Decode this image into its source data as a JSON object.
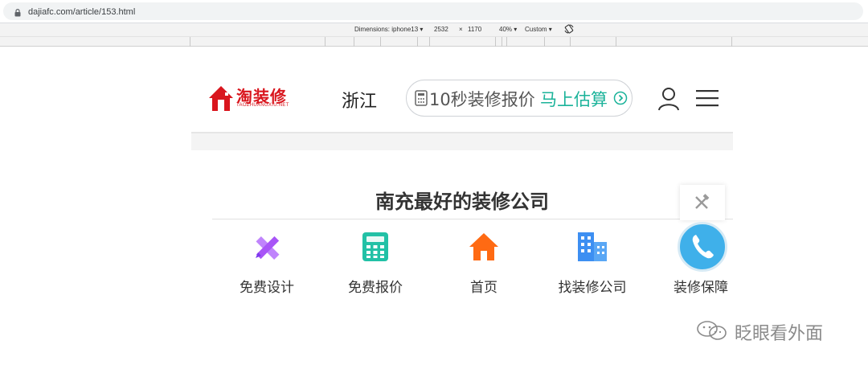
{
  "browser": {
    "url": "dajiafc.com/article/153.html"
  },
  "devtools": {
    "dimensions_label": "Dimensions: iphone13",
    "width": "2532",
    "times": "×",
    "height": "1170",
    "zoom": "40%",
    "throttle": "Custom"
  },
  "header": {
    "logo_text": "淘装修",
    "logo_subtext": "TAOZHUANGXIU.NET",
    "region": "浙江",
    "quote_text": "10秒装修报价",
    "quote_cta": "马上估算"
  },
  "section": {
    "title": "南充最好的装修公司"
  },
  "nav": [
    {
      "label": "免费设计",
      "icon": "pencil-ruler-icon",
      "color": "#a855f7"
    },
    {
      "label": "免费报价",
      "icon": "calculator-icon",
      "color": "#22c1a6"
    },
    {
      "label": "首页",
      "icon": "home-icon",
      "color": "#ff6a13"
    },
    {
      "label": "找装修公司",
      "icon": "building-icon",
      "color": "#3d8ff2"
    },
    {
      "label": "装修保障",
      "icon": "shield-icon",
      "color": "#3fb0ea"
    }
  ],
  "watermark": {
    "text": "眨眼看外面"
  },
  "colors": {
    "brand": "#d9161e",
    "accent": "#1bb39a"
  }
}
